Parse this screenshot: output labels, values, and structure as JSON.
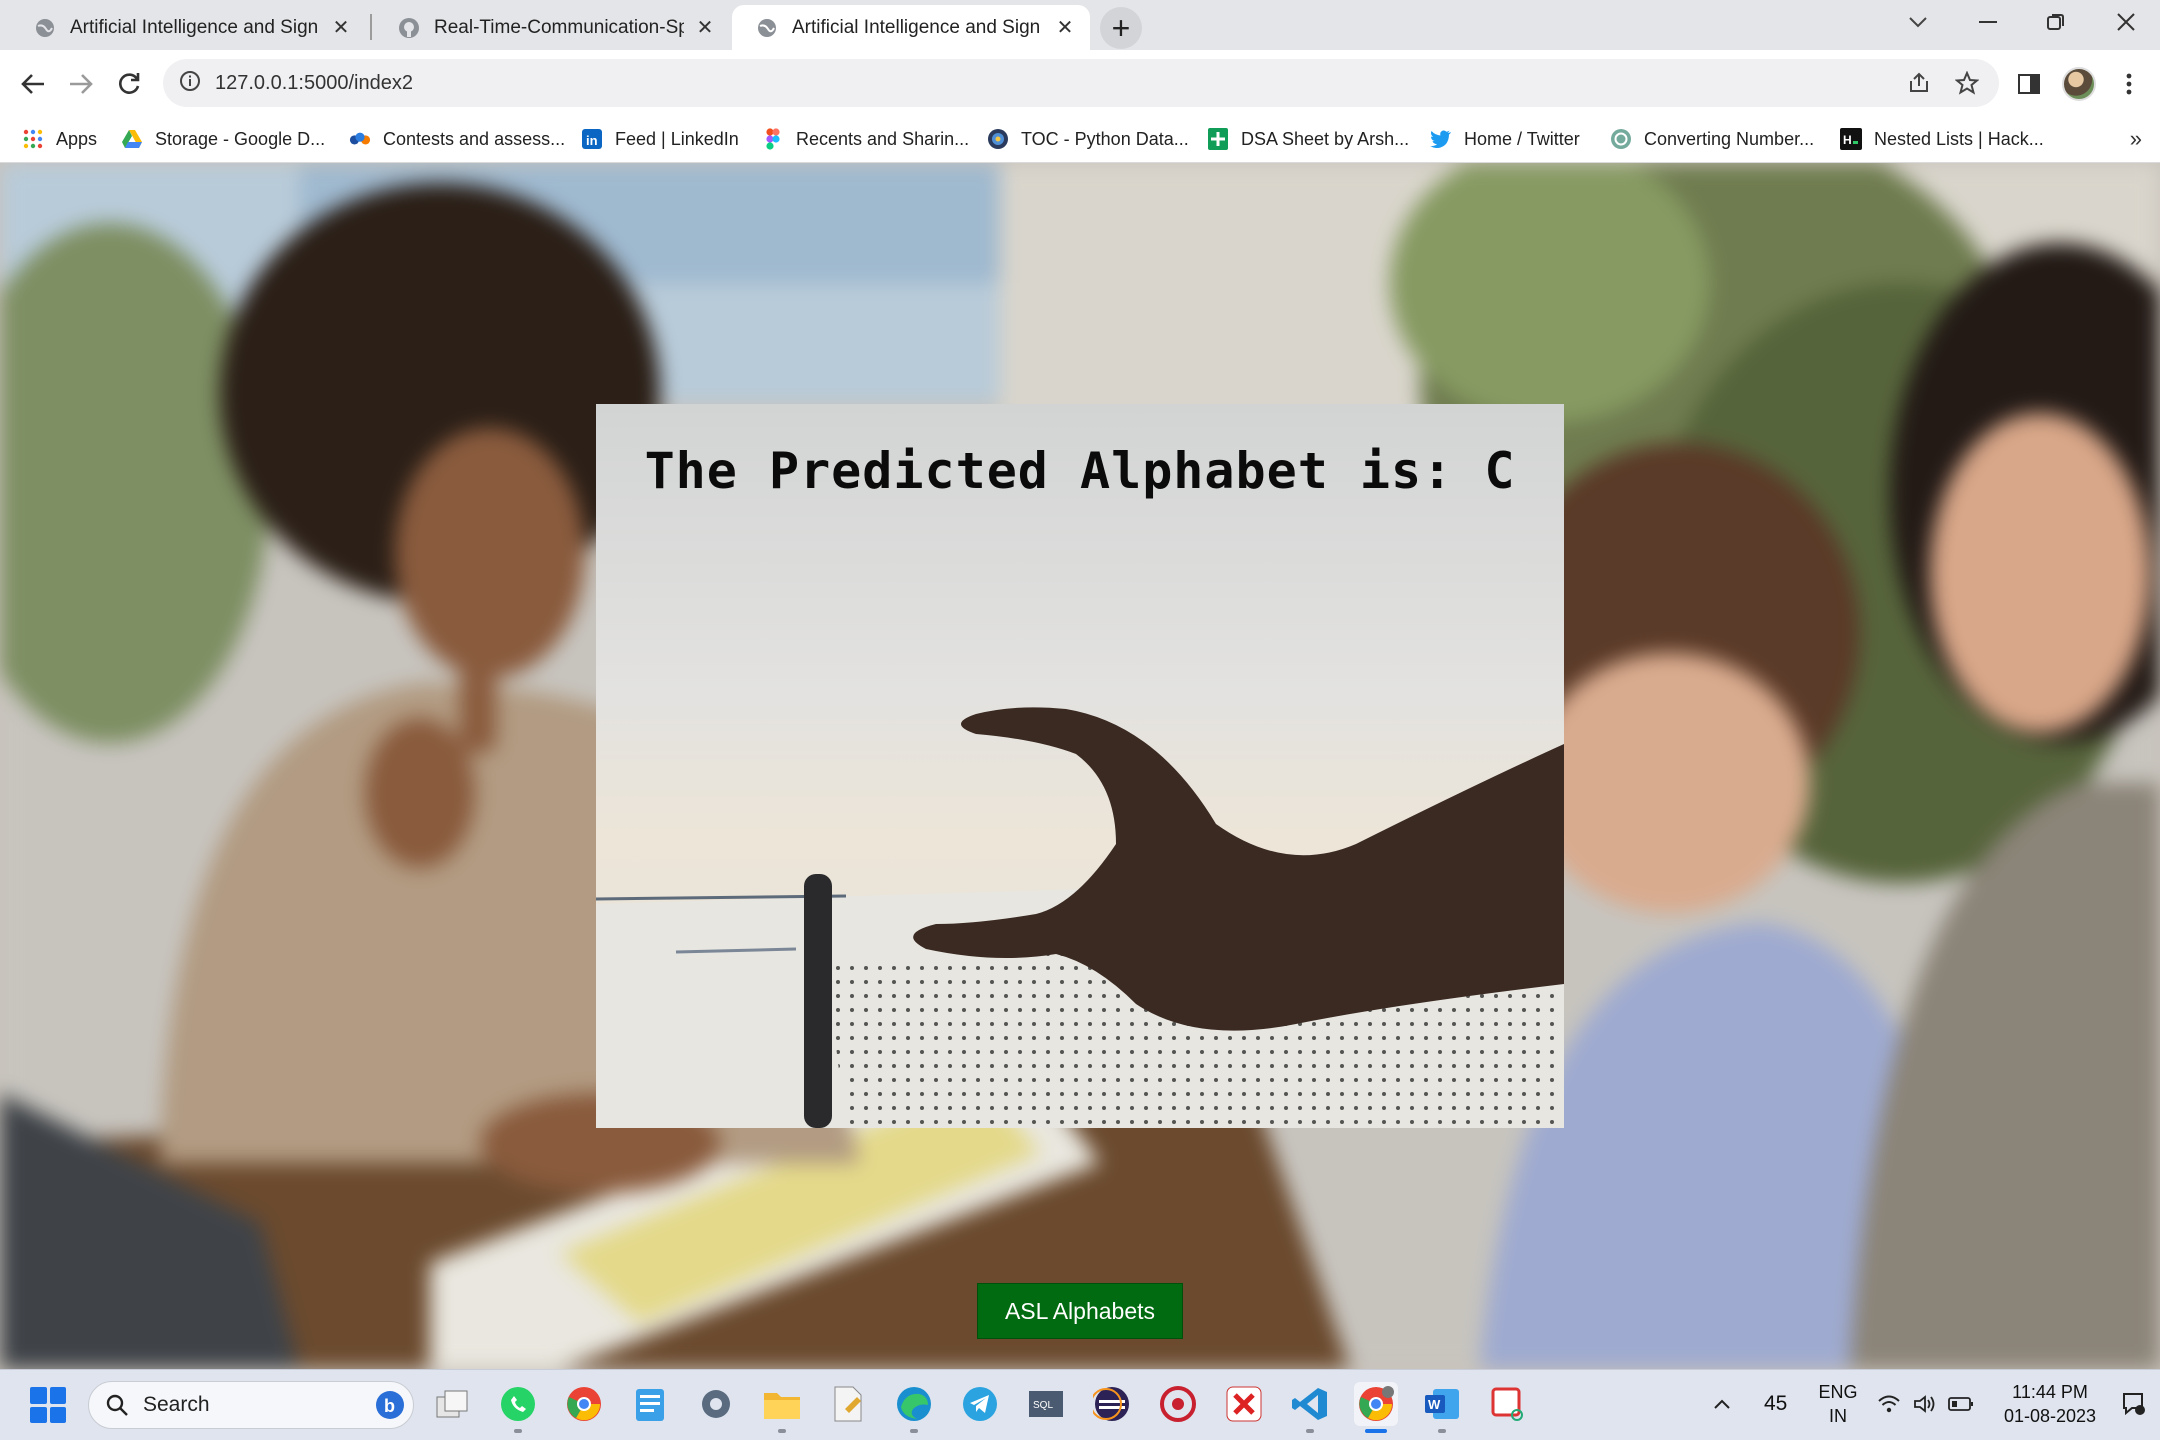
{
  "browser": {
    "tabs": [
      {
        "title": "Artificial Intelligence and Sign Re",
        "active": false,
        "favicon": "globe-icon"
      },
      {
        "title": "Real-Time-Communication-Speci",
        "active": false,
        "favicon": "github-icon"
      },
      {
        "title": "Artificial Intelligence and Sign Re",
        "active": true,
        "favicon": "globe-icon"
      }
    ],
    "url": "127.0.0.1:5000/index2",
    "bookmarks": [
      {
        "label": "Apps",
        "icon": "apps-grid-icon"
      },
      {
        "label": "Storage - Google D...",
        "icon": "google-drive-icon"
      },
      {
        "label": "Contests and assess...",
        "icon": "codestudio-icon"
      },
      {
        "label": "Feed | LinkedIn",
        "icon": "linkedin-icon"
      },
      {
        "label": "Recents and Sharin...",
        "icon": "figma-icon"
      },
      {
        "label": "TOC - Python Data...",
        "icon": "python-icon"
      },
      {
        "label": "DSA Sheet by Arsh...",
        "icon": "sheets-icon"
      },
      {
        "label": "Home / Twitter",
        "icon": "twitter-icon"
      },
      {
        "label": "Converting Number...",
        "icon": "chatgpt-icon"
      },
      {
        "label": "Nested Lists | Hack...",
        "icon": "hackerrank-icon"
      }
    ]
  },
  "page": {
    "prediction_text": "The Predicted Alphabet is: C",
    "asl_button_label": "ASL Alphabets"
  },
  "taskbar": {
    "search_label": "Search",
    "apps": [
      "file-explorer-taskview-icon",
      "whatsapp-icon",
      "chrome-icon",
      "notepad-icon",
      "settings-icon",
      "folder-icon",
      "notepad-plus-icon",
      "edge-icon",
      "telegram-icon",
      "sql-icon",
      "eclipse-icon",
      "antivirus-icon",
      "xampp-icon",
      "vscode-icon",
      "chrome-active-icon",
      "word-icon",
      "snipping-tool-icon"
    ],
    "weather_temp": "45",
    "language": "ENG",
    "region": "IN",
    "time": "11:44 PM",
    "date": "01-08-2023"
  },
  "colors": {
    "asl_button": "#006b10",
    "tab_strip": "#e4e5e8",
    "taskbar": "#dfe4ee"
  }
}
